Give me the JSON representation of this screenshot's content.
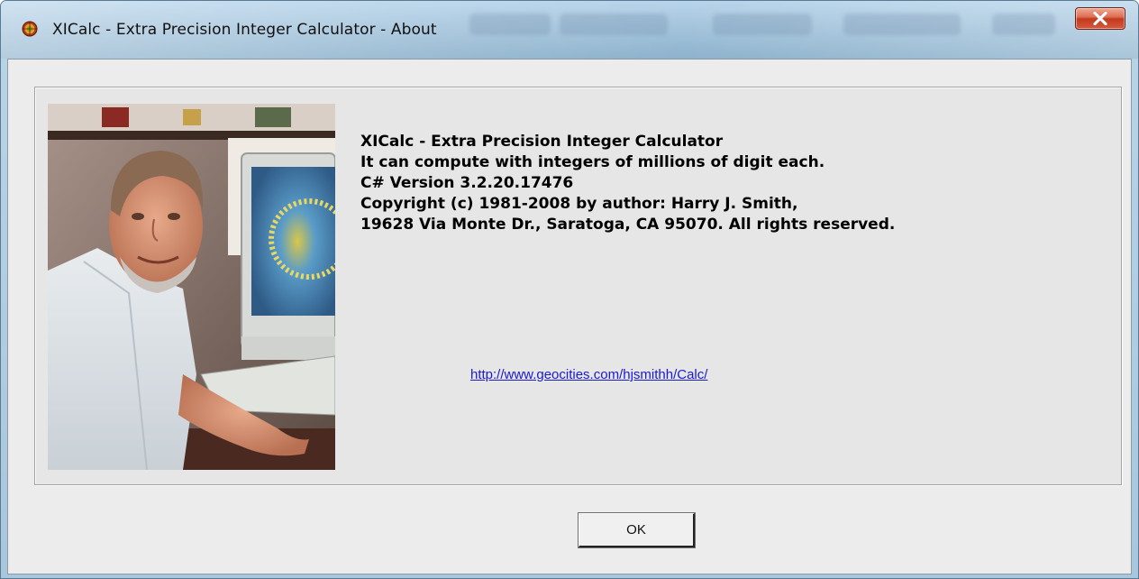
{
  "window": {
    "title": "XICalc - Extra Precision Integer Calculator - About",
    "close_label": "X"
  },
  "about": {
    "lines": [
      "XICalc - Extra Precision Integer Calculator",
      "It can compute with integers of millions of digit each.",
      "C# Version 3.2.20.17476",
      "Copyright (c) 1981-2008 by author: Harry J. Smith,",
      "19628 Via Monte Dr., Saratoga, CA 95070.  All rights reserved."
    ],
    "url": "http://www.geocities.com/hjsmithh/Calc/"
  },
  "buttons": {
    "ok_label": "OK"
  },
  "icons": {
    "app": "xicalc-app-icon",
    "close": "close-icon",
    "photo": "author-photo"
  },
  "colors": {
    "close_button": "#c23a1f",
    "link": "#1a1ad0",
    "dialog_background": "#ececec"
  }
}
